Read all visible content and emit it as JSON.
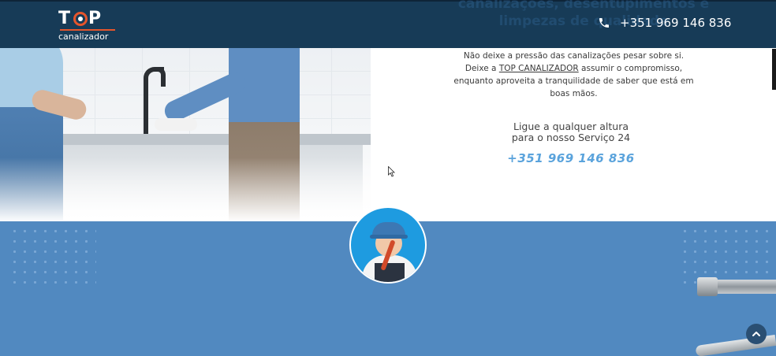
{
  "header": {
    "background_overlay_text": "canalizações, desentupimentos e limpezas de qualidade",
    "logo": {
      "brand_top": "T",
      "brand_top_end": "P",
      "brand_sub": "canalizador"
    },
    "phone_icon": "phone-icon",
    "phone": "+351 969 146 836"
  },
  "intro": {
    "line1": "Não deixe a pressão das canalizações pesar sobre si.",
    "line2_before": "Deixe a",
    "line2_link": "TOP CANALIZADOR",
    "line2_after": "assumir o compromisso,",
    "line3": "enquanto aproveita a tranquilidade de saber que está em",
    "line4": "boas mãos."
  },
  "call": {
    "title_line1": "Ligue a qualquer altura",
    "title_line2": "para o nosso Serviço 24",
    "number": "+351 969 146 836"
  },
  "icons": {
    "scroll_top": "chevron-up-icon",
    "cursor": "cursor-icon",
    "mascot": "plumber-mascot"
  },
  "colors": {
    "header_bg": "#173b57",
    "accent_blue": "#5aa3dc",
    "section_blue": "#5189c0",
    "logo_accent": "#e5552c"
  }
}
